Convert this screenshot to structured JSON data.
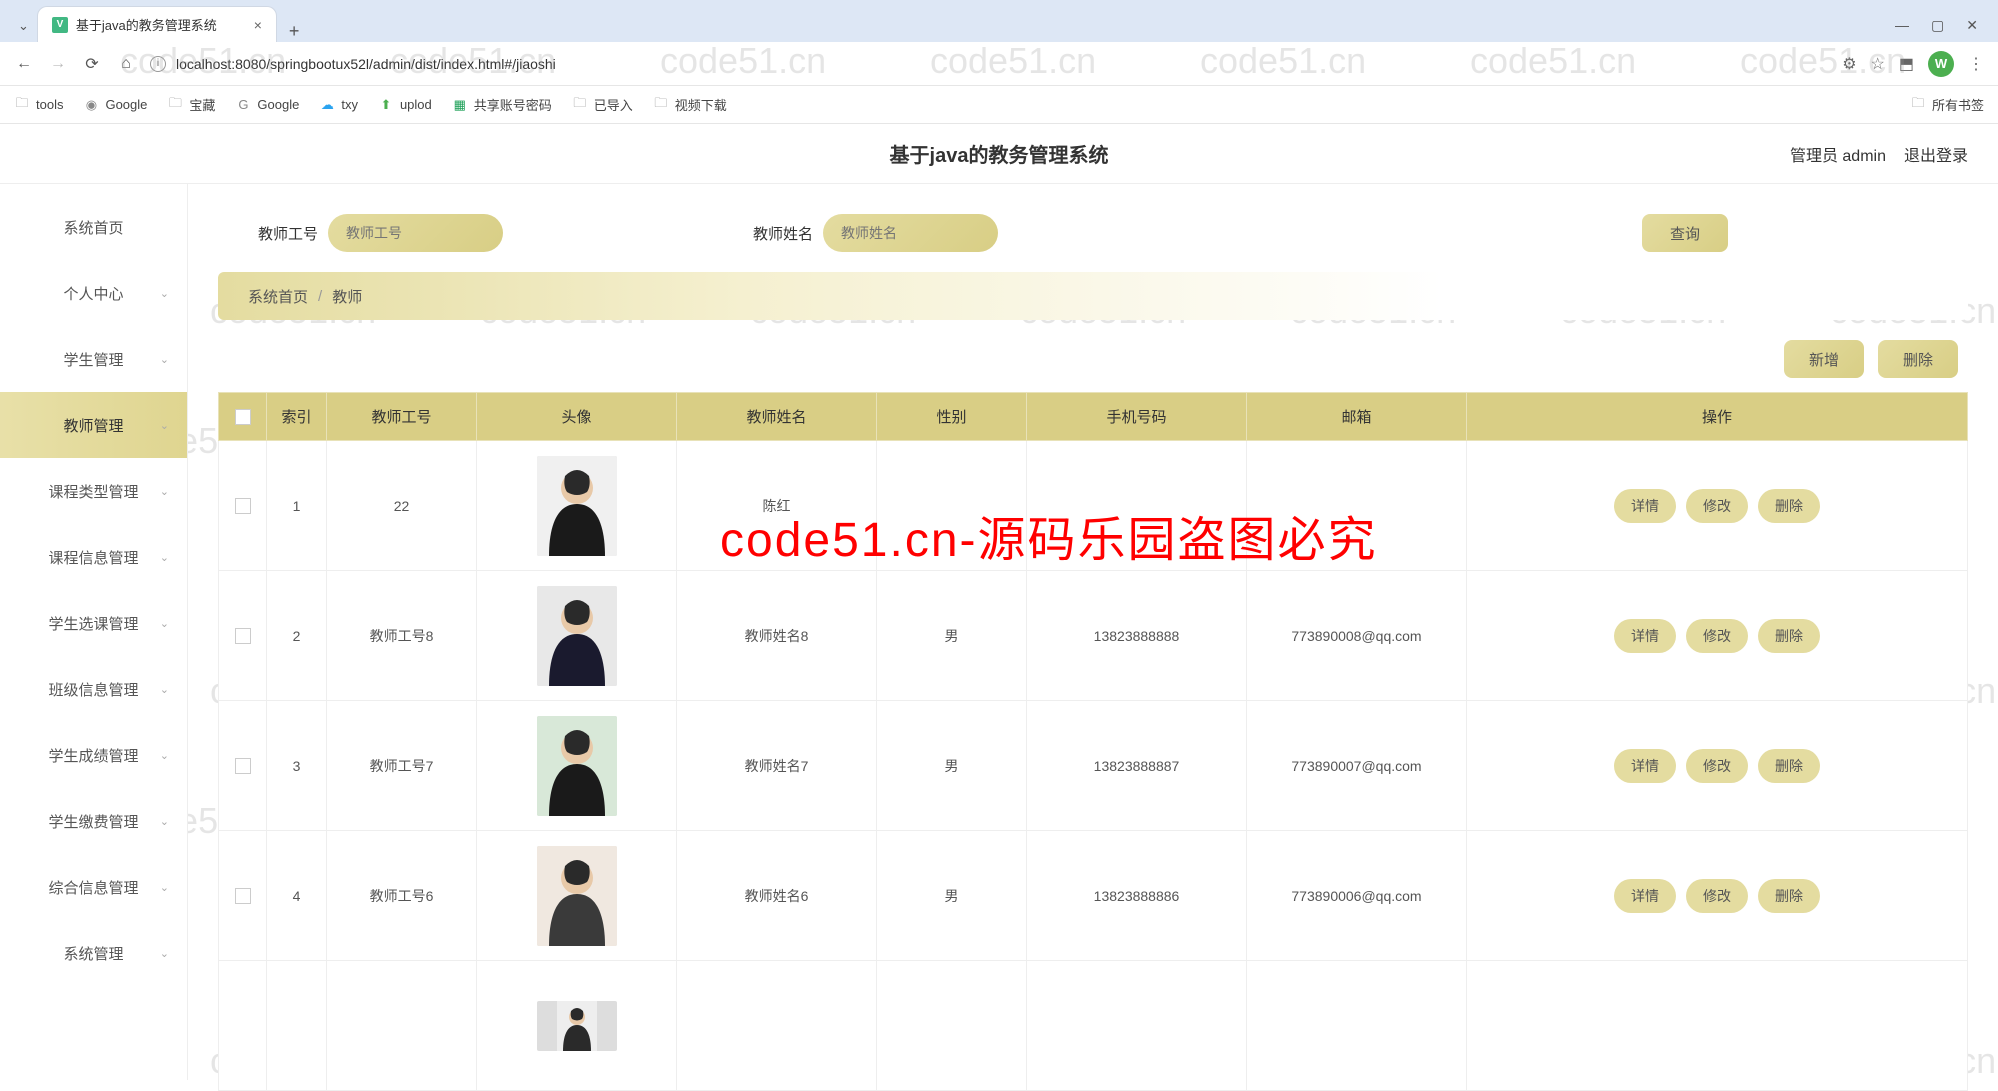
{
  "browser": {
    "tab_title": "基于java的教务管理系统",
    "url": "localhost:8080/springbootux52l/admin/dist/index.html#/jiaoshi",
    "bookmarks": [
      "tools",
      "Google",
      "宝藏",
      "Google",
      "txy",
      "uplod",
      "共享账号密码",
      "已导入",
      "视频下载"
    ],
    "all_bookmarks": "所有书签"
  },
  "header": {
    "title": "基于java的教务管理系统",
    "role_user": "管理员 admin",
    "logout": "退出登录"
  },
  "sidebar": {
    "items": [
      {
        "label": "系统首页",
        "expandable": false
      },
      {
        "label": "个人中心",
        "expandable": true
      },
      {
        "label": "学生管理",
        "expandable": true
      },
      {
        "label": "教师管理",
        "expandable": true,
        "active": true
      },
      {
        "label": "课程类型管理",
        "expandable": true
      },
      {
        "label": "课程信息管理",
        "expandable": true
      },
      {
        "label": "学生选课管理",
        "expandable": true
      },
      {
        "label": "班级信息管理",
        "expandable": true
      },
      {
        "label": "学生成绩管理",
        "expandable": true
      },
      {
        "label": "学生缴费管理",
        "expandable": true
      },
      {
        "label": "综合信息管理",
        "expandable": true
      },
      {
        "label": "系统管理",
        "expandable": true
      }
    ]
  },
  "search": {
    "id_label": "教师工号",
    "id_placeholder": "教师工号",
    "name_label": "教师姓名",
    "name_placeholder": "教师姓名",
    "query_btn": "查询"
  },
  "breadcrumb": {
    "home": "系统首页",
    "current": "教师"
  },
  "actions": {
    "add": "新增",
    "delete": "删除"
  },
  "table": {
    "headers": {
      "index": "索引",
      "id": "教师工号",
      "avatar": "头像",
      "name": "教师姓名",
      "sex": "性别",
      "phone": "手机号码",
      "email": "邮箱",
      "ops": "操作"
    },
    "ops": {
      "detail": "详情",
      "edit": "修改",
      "del": "删除"
    },
    "rows": [
      {
        "index": "1",
        "id": "22",
        "name": "陈红",
        "sex": "",
        "phone": "",
        "email": ""
      },
      {
        "index": "2",
        "id": "教师工号8",
        "name": "教师姓名8",
        "sex": "男",
        "phone": "13823888888",
        "email": "773890008@qq.com"
      },
      {
        "index": "3",
        "id": "教师工号7",
        "name": "教师姓名7",
        "sex": "男",
        "phone": "13823888887",
        "email": "773890007@qq.com"
      },
      {
        "index": "4",
        "id": "教师工号6",
        "name": "教师姓名6",
        "sex": "男",
        "phone": "13823888886",
        "email": "773890006@qq.com"
      }
    ]
  },
  "watermark": "code51.cn",
  "overlay": "code51.cn-源码乐园盗图必究"
}
